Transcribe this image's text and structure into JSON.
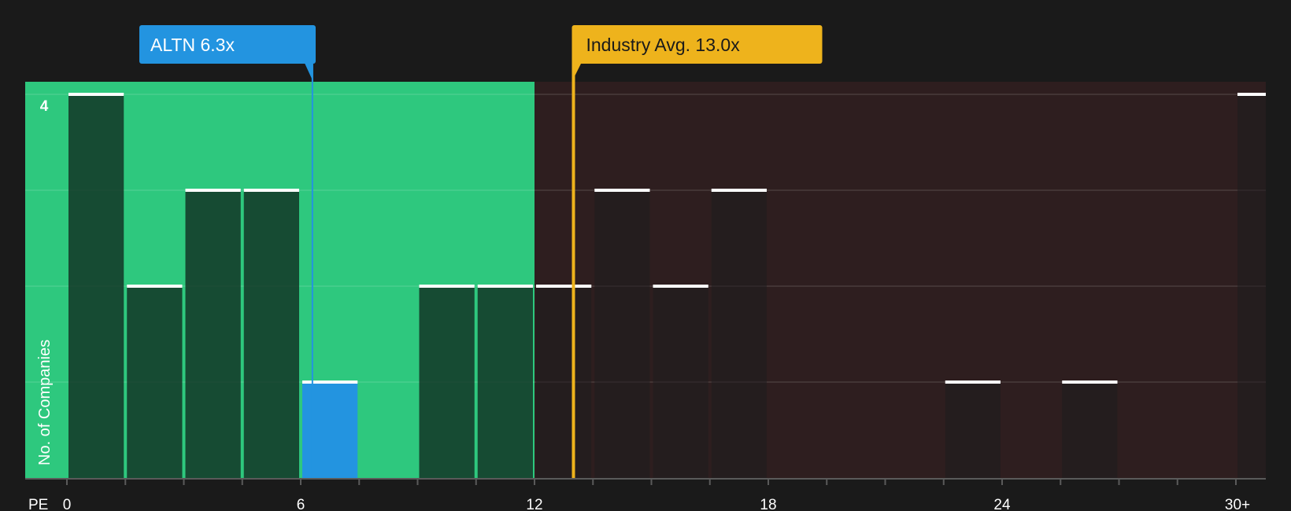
{
  "chart_data": {
    "type": "bar",
    "xlabel": "PE",
    "ylabel": "No. of Companies",
    "x_ticks": [
      {
        "value": 0,
        "label": "0"
      },
      {
        "value": 6,
        "label": "6"
      },
      {
        "value": 12,
        "label": "12"
      },
      {
        "value": 18,
        "label": "18"
      },
      {
        "value": 24,
        "label": "24"
      },
      {
        "value": 30,
        "label": "30+"
      }
    ],
    "y_ticks": [
      {
        "value": 4,
        "label": "4"
      }
    ],
    "xlim": [
      0,
      30
    ],
    "ylim": [
      0,
      4
    ],
    "grid": true,
    "bin_width": 1.5,
    "bins": [
      {
        "start": 0,
        "value": 4
      },
      {
        "start": 1.5,
        "value": 2
      },
      {
        "start": 3,
        "value": 3
      },
      {
        "start": 4.5,
        "value": 3
      },
      {
        "start": 6,
        "value": 1,
        "highlight": true
      },
      {
        "start": 7.5,
        "value": 0
      },
      {
        "start": 9,
        "value": 2
      },
      {
        "start": 10.5,
        "value": 2
      },
      {
        "start": 12,
        "value": 2
      },
      {
        "start": 13.5,
        "value": 3
      },
      {
        "start": 15,
        "value": 2
      },
      {
        "start": 16.5,
        "value": 3
      },
      {
        "start": 18,
        "value": 0
      },
      {
        "start": 19.5,
        "value": 0
      },
      {
        "start": 21,
        "value": 0
      },
      {
        "start": 22.5,
        "value": 1
      },
      {
        "start": 24,
        "value": 0
      },
      {
        "start": 25.5,
        "value": 1
      },
      {
        "start": 27,
        "value": 0
      },
      {
        "start": 28.5,
        "value": 0
      },
      {
        "start": 30,
        "value": 4
      }
    ],
    "markers": [
      {
        "name": "company",
        "label": "ALTN 6.3x",
        "value": 6.3,
        "color": "#2394e0"
      },
      {
        "name": "industry",
        "label": "Industry Avg. 13.0x",
        "value": 13.0,
        "color": "#eeb31c"
      }
    ],
    "zones": {
      "below_industry_avg_color": "#2ec87e",
      "above_industry_avg_color": "#2e1e1f"
    },
    "colors": {
      "background": "#1a1a1a",
      "highlight_bar": "#2394e0"
    }
  }
}
